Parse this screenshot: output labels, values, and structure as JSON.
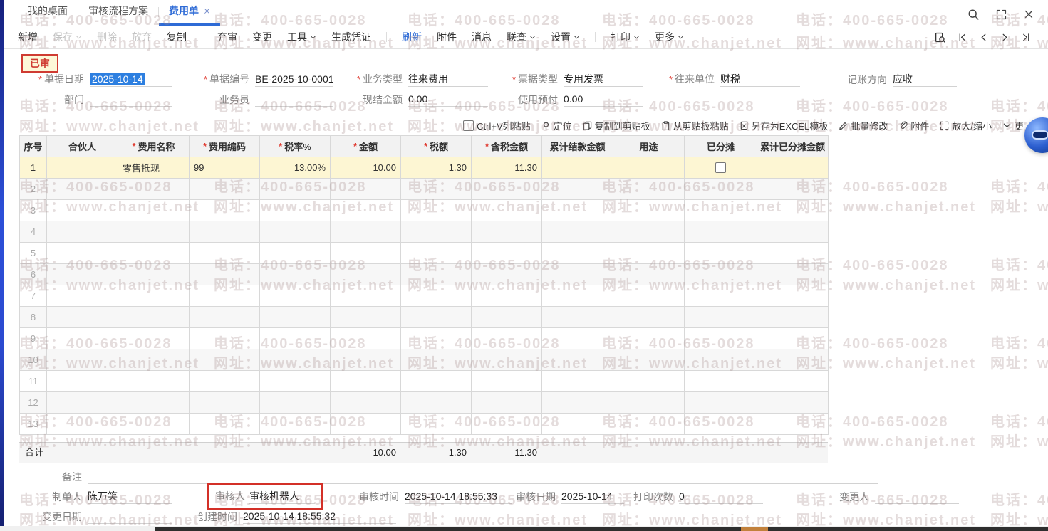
{
  "watermark": {
    "phone": "电话：400-665-0028",
    "site": "网址：www.chanjet.net"
  },
  "tab_bar": {
    "tabs": [
      {
        "label": "我的桌面",
        "active": false,
        "closable": false
      },
      {
        "label": "审核流程方案",
        "active": false,
        "closable": false
      },
      {
        "label": "费用单",
        "active": true,
        "closable": true
      }
    ],
    "window_icons": [
      "search",
      "fullscreen",
      "close"
    ]
  },
  "toolbar": {
    "buttons": [
      {
        "label": "新增"
      },
      {
        "label": "保存",
        "caret": true,
        "disabled": true
      },
      {
        "label": "删除",
        "disabled": true
      },
      {
        "label": "放弃",
        "disabled": true
      },
      {
        "label": "复制"
      },
      {
        "separator": true
      },
      {
        "label": "弃审"
      },
      {
        "label": "变更"
      },
      {
        "label": "工具",
        "caret": true
      },
      {
        "label": "生成凭证"
      },
      {
        "separator": true
      },
      {
        "label": "刷新",
        "accent": true
      },
      {
        "label": "附件"
      },
      {
        "label": "消息"
      },
      {
        "label": "联查",
        "caret": true
      },
      {
        "label": "设置",
        "caret": true
      },
      {
        "separator": true
      },
      {
        "label": "打印",
        "caret": true
      },
      {
        "label": "更多",
        "caret": true
      }
    ],
    "nav_icons": [
      "doc-search",
      "nav-first",
      "nav-prev",
      "nav-next",
      "nav-last"
    ]
  },
  "status_badge": "已审",
  "form": {
    "doc_date": {
      "label": "单据日期",
      "value": "2025-10-14",
      "required": true,
      "selected": true
    },
    "doc_no": {
      "label": "单据编号",
      "value": "BE-2025-10-0001",
      "required": true
    },
    "biz_type": {
      "label": "业务类型",
      "value": "往来费用",
      "required": true
    },
    "bill_type": {
      "label": "票据类型",
      "value": "专用发票",
      "required": true
    },
    "partner": {
      "label": "往来单位",
      "value": "财税",
      "required": true
    },
    "direction": {
      "label": "记账方向",
      "value": "应收",
      "required": false
    },
    "dept": {
      "label": "部门",
      "value": "",
      "required": false
    },
    "salesman": {
      "label": "业务员",
      "value": "",
      "required": false
    },
    "cash_amount": {
      "label": "现结金额",
      "value": "0.00",
      "required": false
    },
    "prepay_used": {
      "label": "使用预付",
      "value": "0.00",
      "required": false
    }
  },
  "grid_toolbar": {
    "items": [
      {
        "icon": "checkbox",
        "label": "Ctrl+V列粘贴"
      },
      {
        "icon": "location-pin",
        "label": "定位"
      },
      {
        "icon": "copy",
        "label": "复制到剪贴板"
      },
      {
        "icon": "paste",
        "label": "从剪贴板粘贴"
      },
      {
        "icon": "excel",
        "label": "另存为EXCEL模板"
      },
      {
        "icon": "batch-edit",
        "label": "批量修改"
      },
      {
        "icon": "paperclip",
        "label": "附件"
      },
      {
        "icon": "resize",
        "label": "放大/缩小"
      },
      {
        "icon": "chevron-down",
        "label": "更"
      }
    ]
  },
  "table": {
    "columns": [
      {
        "label": "序号",
        "required": false
      },
      {
        "label": "合伙人",
        "required": false
      },
      {
        "label": "费用名称",
        "required": true
      },
      {
        "label": "费用编码",
        "required": true
      },
      {
        "label": "税率%",
        "required": true
      },
      {
        "label": "金额",
        "required": true
      },
      {
        "label": "税额",
        "required": true
      },
      {
        "label": "含税金额",
        "required": true
      },
      {
        "label": "累计结款金额",
        "required": false
      },
      {
        "label": "用途",
        "required": false
      },
      {
        "label": "已分摊",
        "required": false
      },
      {
        "label": "累计已分摊金额",
        "required": false
      }
    ],
    "rows": [
      {
        "seq": "1",
        "partner": "",
        "expense_name": "零售抵现",
        "expense_code": "99",
        "tax_rate": "13.00%",
        "amount": "10.00",
        "tax": "1.30",
        "tax_inclusive_amount": "11.30",
        "settled_total": "",
        "usage": "",
        "allocated": false,
        "allocated_total": ""
      }
    ],
    "empty_row_count": 12,
    "footer": {
      "label": "合计",
      "amount": "10.00",
      "tax": "1.30",
      "tax_inclusive_amount": "11.30"
    }
  },
  "footer_fields": {
    "remark": {
      "label": "备注",
      "value": ""
    },
    "maker": {
      "label": "制单人",
      "value": "陈万笑"
    },
    "auditor": {
      "label": "审核人",
      "value": "审核机器人",
      "highlighted": true
    },
    "audit_time": {
      "label": "审核时间",
      "value": "2025-10-14 18:55:33"
    },
    "audit_date": {
      "label": "审核日期",
      "value": "2025-10-14"
    },
    "print_count": {
      "label": "打印次数",
      "value": "0"
    },
    "changer": {
      "label": "变更人",
      "value": ""
    },
    "change_date": {
      "label": "变更日期",
      "value": ""
    },
    "create_time": {
      "label": "创建时间",
      "value": "2025-10-14 18:55:32"
    }
  },
  "colors": {
    "accent_blue": "#2e6bd6",
    "selection_blue": "#2d7fe0",
    "alert_red": "#d33028",
    "row_yellow": "#fdf6d3"
  }
}
